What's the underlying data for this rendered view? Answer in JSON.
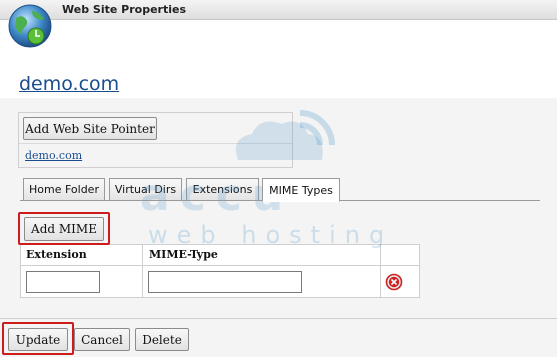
{
  "window": {
    "title": "Web Site Properties"
  },
  "site": {
    "domain": "demo.com"
  },
  "pointers": {
    "add_button": "Add Web Site Pointer",
    "items": [
      "demo.com"
    ]
  },
  "tabs": [
    {
      "label": "Home Folder",
      "active": false
    },
    {
      "label": "Virtual Dirs",
      "active": false
    },
    {
      "label": "Extensions",
      "active": false
    },
    {
      "label": "MIME Types",
      "active": true
    }
  ],
  "mime": {
    "add_button": "Add MIME",
    "columns": [
      "Extension",
      "MIME-Type"
    ],
    "row": {
      "extension": "",
      "mime_type": ""
    }
  },
  "watermark": {
    "word1": "accu",
    "word2": "web hosting"
  },
  "footer": {
    "update": "Update",
    "cancel": "Cancel",
    "delete": "Delete"
  },
  "colors": {
    "highlight": "#cc1c1c",
    "link": "#1a4d8f",
    "delete_icon": "#cc2222"
  }
}
